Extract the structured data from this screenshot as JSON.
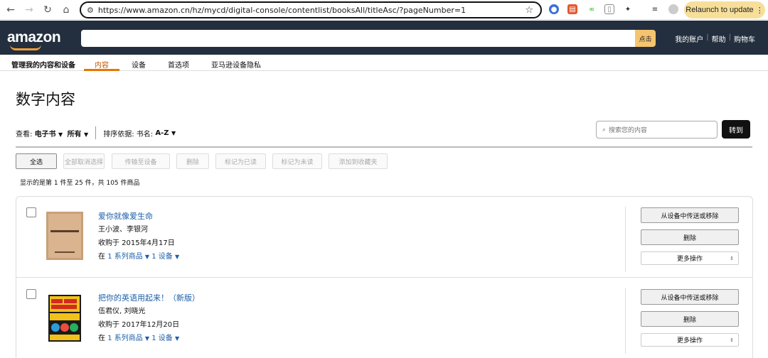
{
  "browser": {
    "url": "https://www.amazon.cn/hz/mycd/digital-console/contentlist/booksAll/titleAsc/?pageNumber=1",
    "relaunch_label": "Relaunch to update"
  },
  "header": {
    "logo": "amazon",
    "search_button": "点击",
    "links": [
      "我的账户",
      "帮助",
      "购物车"
    ]
  },
  "subnav": {
    "items": [
      "管理我的内容和设备",
      "内容",
      "设备",
      "首选项",
      "亚马逊设备隐私"
    ]
  },
  "page": {
    "title": "数字内容",
    "view_label": "查看:",
    "view_type": "电子书",
    "view_filter": "所有",
    "sort_label": "排序依据: 书名:",
    "sort_value": "A-Z",
    "search_placeholder": "搜索您的内容",
    "goto_label": "转到",
    "count_text": "显示的是第 1 件至 25 件，共 105 件商品"
  },
  "toolbar": [
    "全选",
    "全部取消选择",
    "传输至设备",
    "删除",
    "标记为已读",
    "标记为未读",
    "添加到收藏夹"
  ],
  "books": [
    {
      "title": "爱你就像爱生命",
      "author": "王小波、李银河",
      "date": "收购于 2015年4月17日",
      "in": "在",
      "series": "1 系列商品",
      "devices": "1 设备"
    },
    {
      "title": "把你的英语用起来！（新版）",
      "author": "伍君仪, 刘晓光",
      "date": "收购于 2017年12月20日",
      "in": "在",
      "series": "1 系列商品",
      "devices": "1 设备"
    }
  ],
  "actions": {
    "transfer": "从设备中传送或移除",
    "delete": "删除",
    "more": "更多操作"
  }
}
